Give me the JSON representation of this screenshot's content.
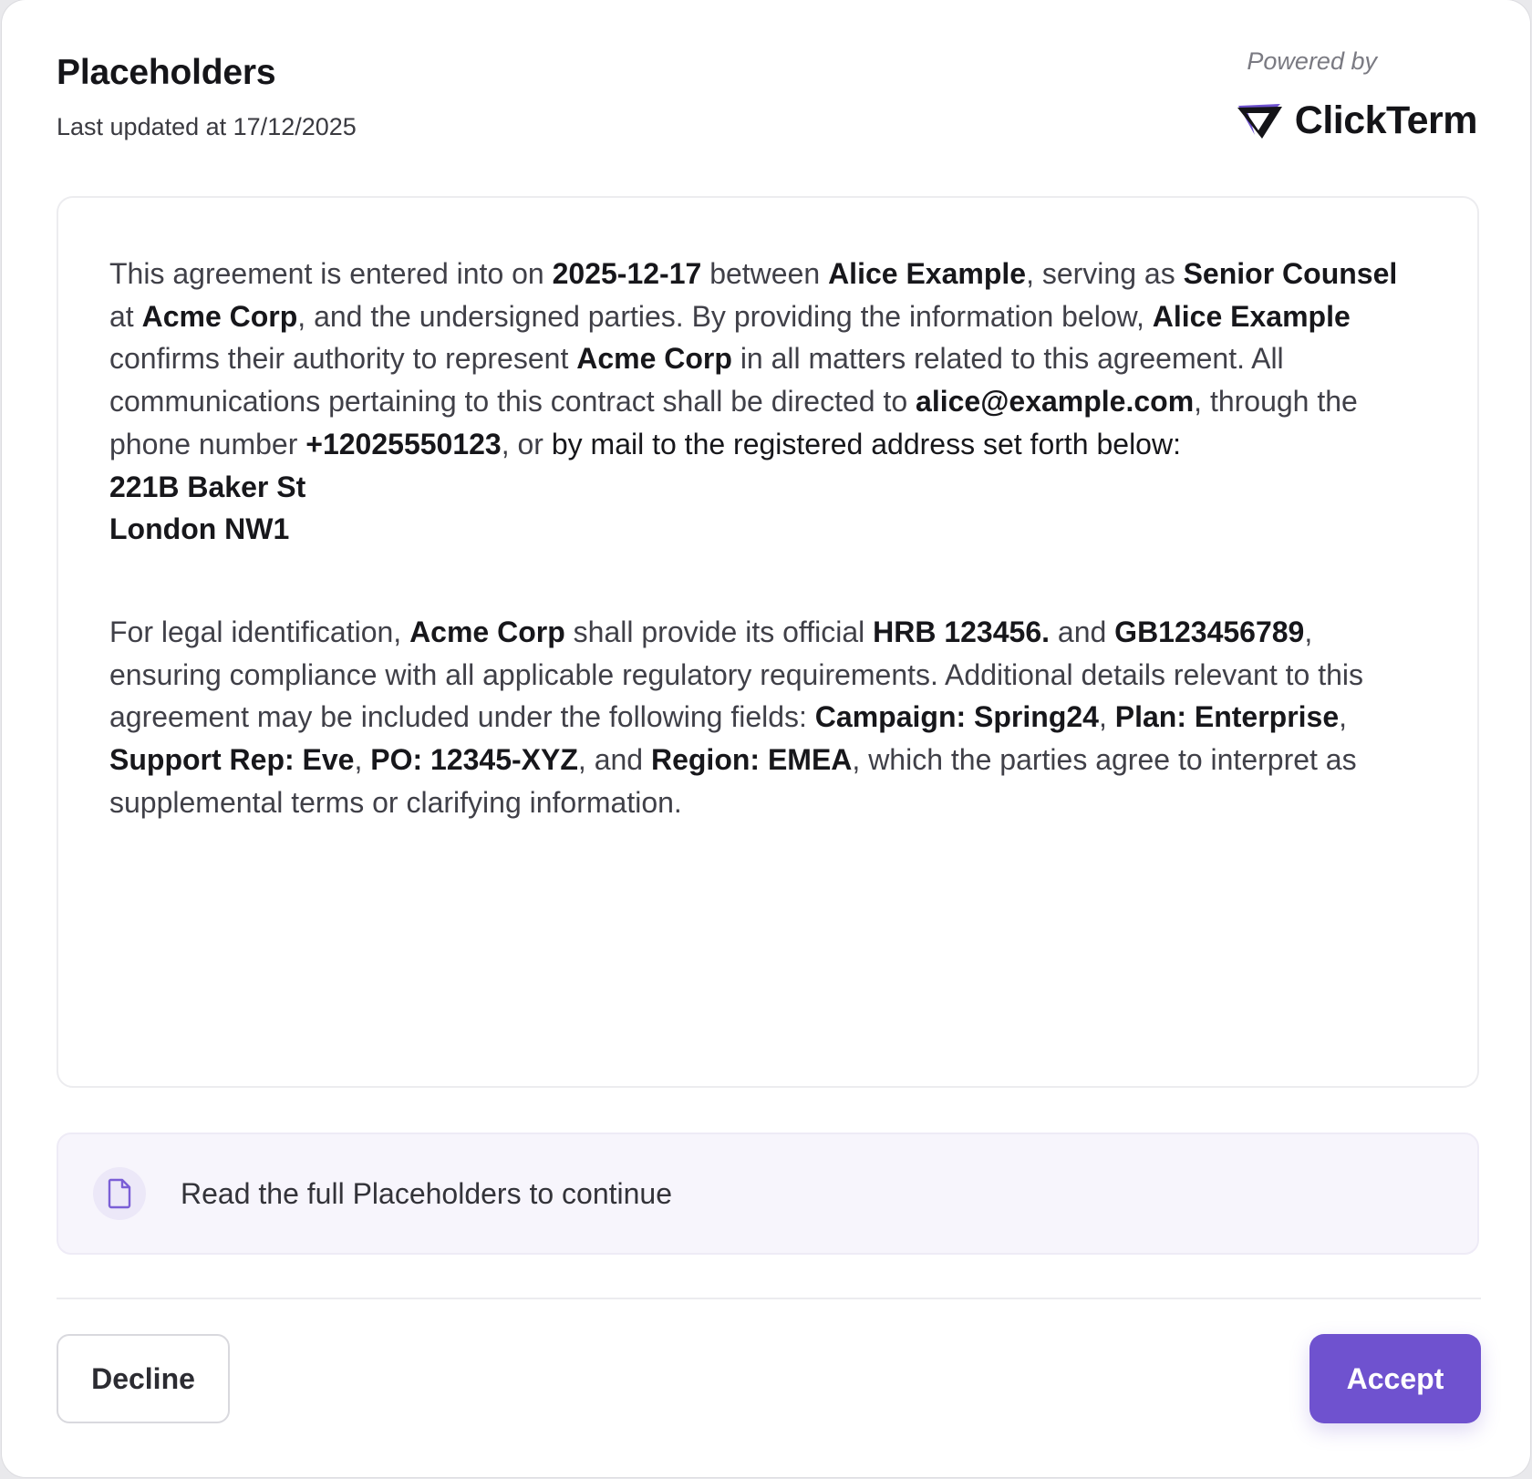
{
  "header": {
    "title": "Placeholders",
    "last_updated": "Last updated at 17/12/2025"
  },
  "brand": {
    "powered_by": "Powered by",
    "name": "ClickTerm",
    "accent_color": "#6f52cf"
  },
  "document": {
    "p1": {
      "t1": "This agreement is entered into on ",
      "date": "2025-12-17",
      "t2": " between ",
      "name1": "Alice Example",
      "t3": ", serving as ",
      "role": "Senior Counsel",
      "t4": " at ",
      "company1": "Acme Corp",
      "t5": ", and the undersigned parties. By providing the information below, ",
      "name2": "Alice Example",
      "t6": " confirms their authority to represent ",
      "company2": "Acme Corp",
      "t7": " in all matters related to this agreement. All communications pertaining to this contract shall be directed to ",
      "email": "alice@example.com",
      "t8": ", through the phone number ",
      "phone": "+12025550123",
      "t9": ", or ",
      "t10": "by mail to the registered address set forth below:",
      "address_line1": "221B Baker St",
      "address_line2": "London NW1"
    },
    "p2": {
      "t1": "For legal identification, ",
      "company": "Acme Corp",
      "t2": " shall provide its official ",
      "reg": "HRB 123456.",
      "t3": " and ",
      "vat": "GB123456789",
      "t4": ", ensuring compliance with all applicable regulatory requirements. Additional details relevant to this agreement may be included under the following fields: ",
      "f1": "Campaign: Spring24",
      "s1": ", ",
      "f2": "Plan: Enterprise",
      "s2": ", ",
      "f3": "Support Rep: Eve",
      "s3": ", ",
      "f4": "PO: 12345-XYZ",
      "s4": ", and ",
      "f5": "Region: EMEA",
      "t5": ", which the parties agree to interpret as supplemental terms or clarifying information."
    }
  },
  "notice": {
    "icon": "document-icon",
    "text": "Read the full Placeholders to continue"
  },
  "actions": {
    "decline_label": "Decline",
    "accept_label": "Accept"
  }
}
